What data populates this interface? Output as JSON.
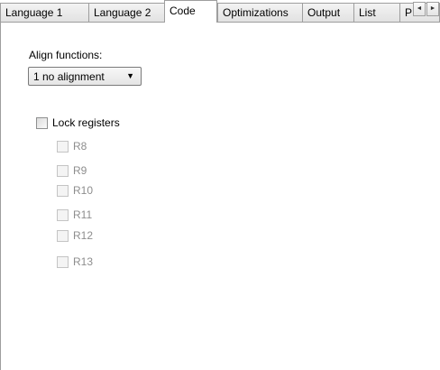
{
  "tabs": [
    {
      "label": "Language 1",
      "selected": false
    },
    {
      "label": "Language 2",
      "selected": false
    },
    {
      "label": "Code",
      "selected": true
    },
    {
      "label": "Optimizations",
      "selected": false
    },
    {
      "label": "Output",
      "selected": false
    },
    {
      "label": "List",
      "selected": false
    },
    {
      "label": "P",
      "selected": false
    }
  ],
  "tab_scroll": {
    "left": "◄",
    "right": "►"
  },
  "align": {
    "label": "Align functions:",
    "value": "1 no alignment",
    "arrow": "▼"
  },
  "lock": {
    "label": "Lock registers",
    "checked": false,
    "registers": [
      {
        "label": "R8",
        "checked": false,
        "enabled": false
      },
      {
        "label": "R9",
        "checked": false,
        "enabled": false
      },
      {
        "label": "R10",
        "checked": false,
        "enabled": false
      },
      {
        "label": "R11",
        "checked": false,
        "enabled": false
      },
      {
        "label": "R12",
        "checked": false,
        "enabled": false
      },
      {
        "label": "R13",
        "checked": false,
        "enabled": false
      }
    ]
  }
}
